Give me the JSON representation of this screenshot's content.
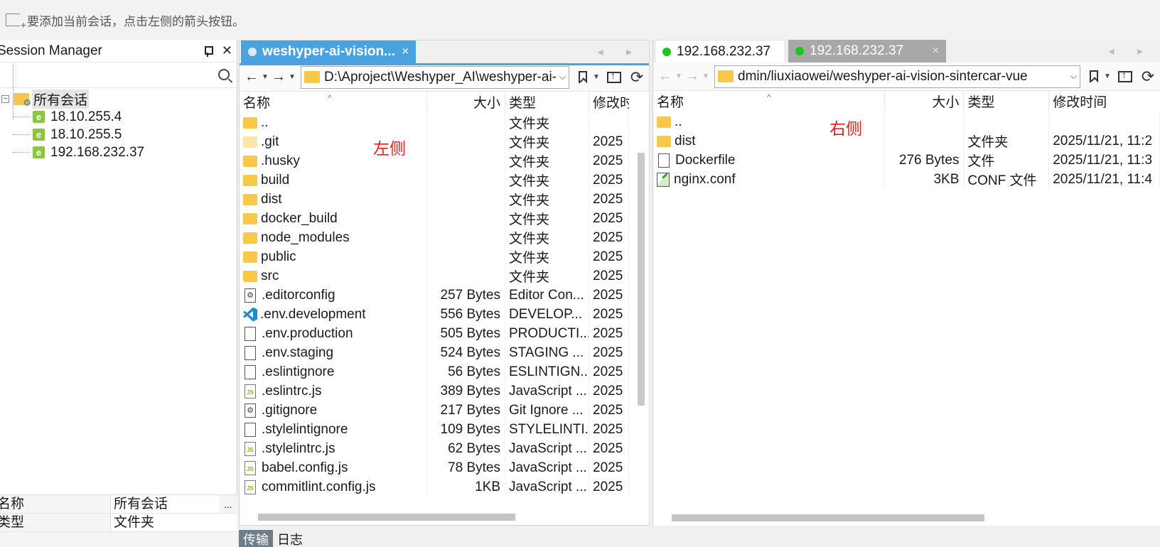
{
  "hint": {
    "text": "要添加当前会话，点击左侧的箭头按钮。"
  },
  "session_manager": {
    "title": "Session Manager",
    "root": {
      "label": "所有会话",
      "expander": "−"
    },
    "sessions": [
      {
        "label": "18.10.255.4",
        "icon_letter": "e"
      },
      {
        "label": "18.10.255.5",
        "icon_letter": "e"
      },
      {
        "label": "192.168.232.37",
        "icon_letter": "e"
      }
    ],
    "properties": [
      {
        "key": "名称",
        "value": "所有会话",
        "action": "..."
      },
      {
        "key": "类型",
        "value": "文件夹"
      }
    ]
  },
  "left_pane": {
    "tab_label": "weshyper-ai-vision...",
    "tab_close": "×",
    "tab_nav": "◂ ▸",
    "path": "D:\\Aproject\\Weshyper_AI\\weshyper-ai-vision-sintercar-vue",
    "annotation": "左侧",
    "columns": [
      "名称",
      "大小",
      "类型",
      "修改时间"
    ],
    "rows": [
      {
        "name": "..",
        "size": "",
        "type": "文件夹",
        "modified": "",
        "icon": "folder"
      },
      {
        "name": ".git",
        "size": "",
        "type": "文件夹",
        "modified": "2025",
        "icon": "folder-light"
      },
      {
        "name": ".husky",
        "size": "",
        "type": "文件夹",
        "modified": "2025",
        "icon": "folder"
      },
      {
        "name": "build",
        "size": "",
        "type": "文件夹",
        "modified": "2025",
        "icon": "folder"
      },
      {
        "name": "dist",
        "size": "",
        "type": "文件夹",
        "modified": "2025",
        "icon": "folder"
      },
      {
        "name": "docker_build",
        "size": "",
        "type": "文件夹",
        "modified": "2025",
        "icon": "folder"
      },
      {
        "name": "node_modules",
        "size": "",
        "type": "文件夹",
        "modified": "2025",
        "icon": "folder"
      },
      {
        "name": "public",
        "size": "",
        "type": "文件夹",
        "modified": "2025",
        "icon": "folder"
      },
      {
        "name": "src",
        "size": "",
        "type": "文件夹",
        "modified": "2025",
        "icon": "folder"
      },
      {
        "name": ".editorconfig",
        "size": "257 Bytes",
        "type": "Editor Con...",
        "modified": "2025",
        "icon": "gear"
      },
      {
        "name": ".env.development",
        "size": "556 Bytes",
        "type": "DEVELOP...",
        "modified": "2025",
        "icon": "vscode"
      },
      {
        "name": ".env.production",
        "size": "505 Bytes",
        "type": "PRODUCTI...",
        "modified": "2025",
        "icon": "doc"
      },
      {
        "name": ".env.staging",
        "size": "524 Bytes",
        "type": "STAGING ...",
        "modified": "2025",
        "icon": "doc"
      },
      {
        "name": ".eslintignore",
        "size": "56 Bytes",
        "type": "ESLINTIGN...",
        "modified": "2025",
        "icon": "doc"
      },
      {
        "name": ".eslintrc.js",
        "size": "389 Bytes",
        "type": "JavaScript ...",
        "modified": "2025",
        "icon": "js"
      },
      {
        "name": ".gitignore",
        "size": "217 Bytes",
        "type": "Git Ignore ...",
        "modified": "2025",
        "icon": "gear"
      },
      {
        "name": ".stylelintignore",
        "size": "109 Bytes",
        "type": "STYLELINTI...",
        "modified": "2025",
        "icon": "doc"
      },
      {
        "name": ".stylelintrc.js",
        "size": "62 Bytes",
        "type": "JavaScript ...",
        "modified": "2025",
        "icon": "js"
      },
      {
        "name": "babel.config.js",
        "size": "78 Bytes",
        "type": "JavaScript ...",
        "modified": "2025",
        "icon": "js"
      },
      {
        "name": "commitlint.config.js",
        "size": "1KB",
        "type": "JavaScript ...",
        "modified": "2025",
        "icon": "js"
      }
    ]
  },
  "right_pane": {
    "tabs": [
      {
        "label": "192.168.232.37",
        "status_color": "#1ec31e"
      },
      {
        "label": "192.168.232.37",
        "status_color": "#1ec31e",
        "close": "×"
      }
    ],
    "tab_nav": "◂ ▸",
    "path": "dmin/liuxiaowei/weshyper-ai-vision-sintercar-vue",
    "annotation": "右侧",
    "columns": [
      "名称",
      "大小",
      "类型",
      "修改时间"
    ],
    "rows": [
      {
        "name": "..",
        "size": "",
        "type": "",
        "modified": "",
        "icon": "folder"
      },
      {
        "name": "dist",
        "size": "",
        "type": "文件夹",
        "modified": "2025/11/21, 11:2",
        "icon": "folder"
      },
      {
        "name": "Dockerfile",
        "size": "276 Bytes",
        "type": "文件",
        "modified": "2025/11/21, 11:3",
        "icon": "doc"
      },
      {
        "name": "nginx.conf",
        "size": "3KB",
        "type": "CONF 文件",
        "modified": "2025/11/21, 11:4",
        "icon": "conf"
      }
    ]
  },
  "bottom_tabs": [
    {
      "label": "传输",
      "active": true
    },
    {
      "label": "日志",
      "active": false
    }
  ],
  "colors": {
    "accent": "#4aa3df",
    "folder": "#f7c948",
    "online": "#1ec31e",
    "annotation": "#e0201b"
  }
}
